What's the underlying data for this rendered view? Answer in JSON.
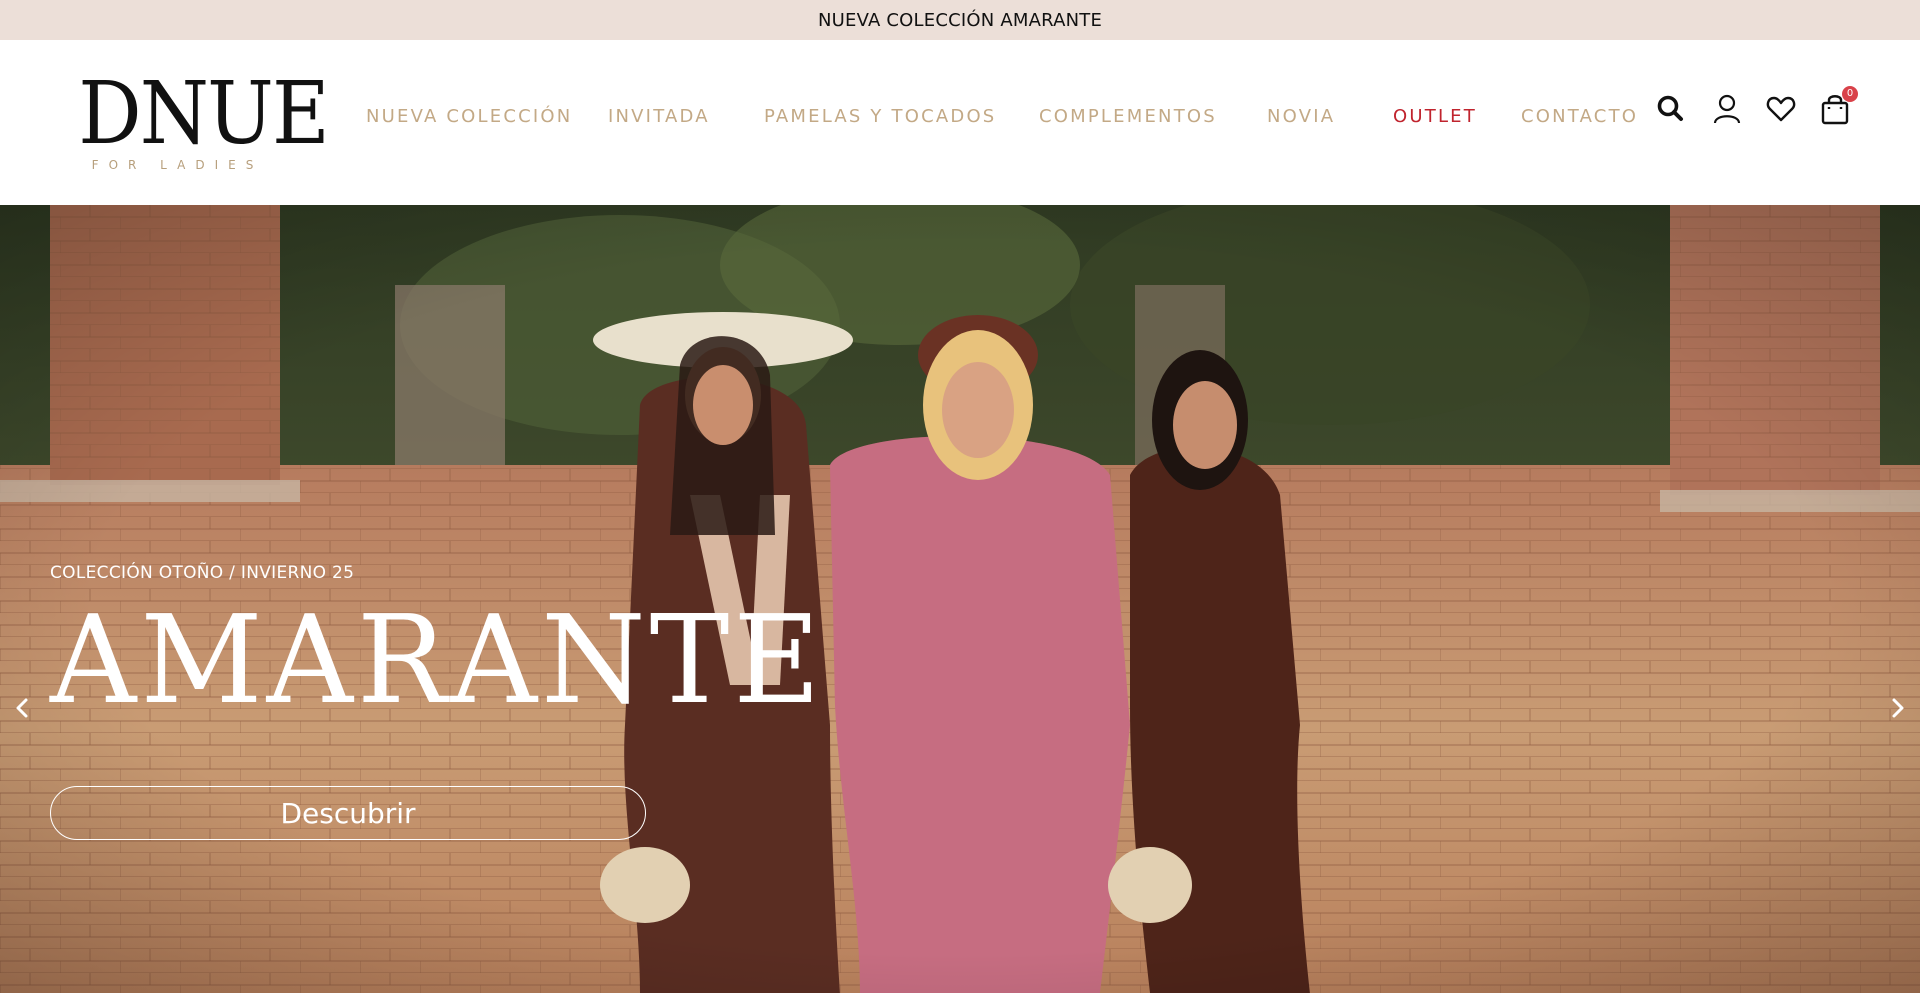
{
  "announcement": {
    "text": "NUEVA COLECCIÓN AMARANTE"
  },
  "brand": {
    "name": "DNUE",
    "tagline": "FOR LADIES"
  },
  "nav": {
    "items": [
      {
        "label": "NUEVA COLECCIÓN"
      },
      {
        "label": "INVITADA"
      },
      {
        "label": "PAMELAS Y TOCADOS"
      },
      {
        "label": "COMPLEMENTOS"
      },
      {
        "label": "NOVIA"
      },
      {
        "label": "OUTLET",
        "color": "#c0242e"
      },
      {
        "label": "CONTACTO"
      }
    ],
    "link_color": "#c3a986"
  },
  "header_icons": {
    "search": "search-icon",
    "account": "user-icon",
    "wishlist": "heart-icon",
    "cart": "shopping-bag-icon",
    "cart_count": "0"
  },
  "hero": {
    "eyebrow": "COLECCIÓN OTOÑO / INVIERNO 25",
    "title": "AMARANTE",
    "button_label": "Descubrir",
    "prev_icon": "chevron-left-icon",
    "next_icon": "chevron-right-icon"
  },
  "colors": {
    "announcement_bg": "#ecdfd8",
    "outlet": "#c0242e",
    "badge": "#d9424a"
  }
}
